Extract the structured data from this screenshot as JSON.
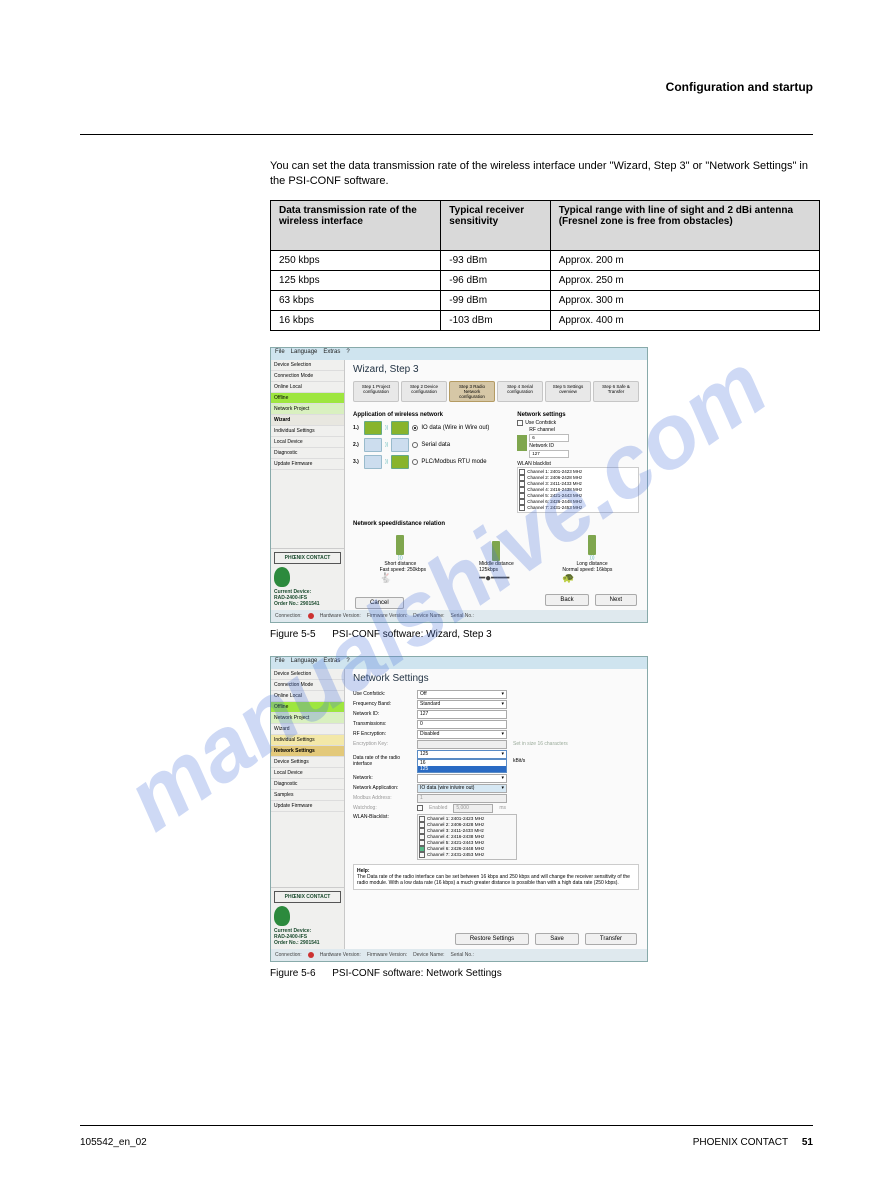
{
  "header": {
    "title": "Configuration and startup"
  },
  "intro": "You can set the data transmission rate of the wireless interface under \"Wizard, Step 3\" or \"Network Settings\" in the PSI-CONF software.",
  "table": {
    "headers": [
      "Data transmission rate of the wireless interface",
      "Typical receiver sensitivity",
      "Typical range with line of sight and 2 dBi antenna (Fresnel zone is free from obstacles)"
    ],
    "rows": [
      [
        "250 kbps",
        "-93 dBm",
        "Approx. 200 m"
      ],
      [
        "125 kbps",
        "-96 dBm",
        "Approx. 250 m"
      ],
      [
        "63 kbps",
        "-99 dBm",
        "Approx. 300 m"
      ],
      [
        "16 kbps",
        "-103 dBm",
        "Approx. 400 m"
      ]
    ]
  },
  "fig_a": {
    "caption_num": "Figure 5-5",
    "caption_text": "PSI-CONF software: Wizard, Step 3",
    "menu": [
      "File",
      "Language",
      "Extras",
      "?"
    ],
    "sidebar": [
      "Device Selection",
      "Connection Mode",
      "Online Local",
      "Offline",
      "Network Project",
      "Wizard",
      "Individual Settings",
      "Local Device",
      "Diagnostic",
      "",
      "Update Firmware"
    ],
    "panel_title": "Wizard, Step 3",
    "steps": [
      "Step 1\nProject configuration",
      "Step 2\nDevice configuration",
      "Step 3\nRadio Network configuration",
      "Step 4\nSerial configuration",
      "Step 5\nSettings overview",
      "Step 6\nSafe & Transfer"
    ],
    "section_app": "Application of wireless network",
    "section_net": "Network settings",
    "app_opts": [
      "IO data (Wire in Wire out)",
      "Serial data",
      "PLC/Modbus RTU mode"
    ],
    "net": {
      "use_confstick": "Use Confstick",
      "rf_channel": "RF channel",
      "rf_value": "6",
      "network_id": "Network ID",
      "network_id_value": "127",
      "block_label": "WLAN blacklist",
      "channels": [
        "Channel 1: 2401-2423 MHz",
        "Channel 2: 2406-2428 MHz",
        "Channel 3: 2411-2433 MHz",
        "Channel 4: 2416-2438 MHz",
        "Channel 5: 2421-2443 MHz",
        "Channel 6: 2426-2448 MHz",
        "Channel 7: 2431-2453 MHz"
      ],
      "chan_icon": "▦"
    },
    "speed": {
      "label": "Network speed/distance relation",
      "short": "Short distance",
      "middle": "Middle distance",
      "long": "Long distance",
      "fast": "Fast speed: 250kbps",
      "mid": "125kbps",
      "normal": "Normal speed: 16kbps"
    },
    "back": "Back",
    "next": "Next",
    "cancel": "Cancel",
    "brand": "PHŒNIX CONTACT",
    "current": "Current Device:",
    "dev": "RAD-2400-IFS",
    "ord": "Order No.: 2901541",
    "status": [
      "Connection:",
      "Hardware Version:",
      "Firmware Version:",
      "Device Name:",
      "Serial No.:"
    ]
  },
  "fig_b": {
    "caption_num": "Figure 5-6",
    "caption_text": "PSI-CONF software: Network Settings",
    "menu": [
      "File",
      "Language",
      "Extras",
      "?"
    ],
    "sidebar": [
      "Device Selection",
      "Connection Mode",
      "Online Local",
      "Offline",
      "Network Project",
      "Wizard",
      "Individual Settings",
      "Network Settings",
      "Device Settings",
      "Local Device",
      "Diagnostic",
      "Samples",
      "Update Firmware"
    ],
    "panel_title": "Network Settings",
    "fields": {
      "use_confstick": {
        "label": "Use Confstick:",
        "value": "Off"
      },
      "freq_band": {
        "label": "Frequency Band:",
        "value": "Standard"
      },
      "network_id": {
        "label": "Network ID:",
        "value": "127"
      },
      "transmissions": {
        "label": "Transmissions:",
        "value": "0"
      },
      "rf_encryption": {
        "label": "RF Encryption:",
        "value": "Disabled"
      },
      "enc_key": {
        "label": "Encryption Key:",
        "hint": "Set in size 16 characters"
      },
      "data_rate": {
        "label": "Data rate of the radio interface",
        "value": "125",
        "unit": " kBit/s",
        "opts": [
          "16",
          "125"
        ]
      },
      "network": {
        "label": "Network:",
        "value": ""
      },
      "net_app": {
        "label": "Network Application:",
        "value": "IO data (wire in/wire out)"
      },
      "modbus": {
        "label": "Modbus Address:",
        "value": "1"
      },
      "watchdog": {
        "label": "Watchdog:",
        "enabled": "Enabled",
        "value": "5,000",
        "unit": "ms"
      },
      "wlan": {
        "label": "WLAN-Blacklist:",
        "channels": [
          "Channel 1: 2401-2423 MHz",
          "Channel 2: 2406-2428 MHz",
          "Channel 3: 2411-2433 MHz",
          "Channel 4: 2416-2438 MHz",
          "Channel 5: 2421-2443 MHz",
          "Channel 6: 2426-2448 MHz",
          "Channel 7: 2431-2453 MHz"
        ]
      }
    },
    "help_label": "Help:",
    "help_text": "The Data rate of the radio interface can be set between 16 kbps and 250 kbps and will change the receiver sensitivity of the radio module. With a low data rate (16 kbps) a much greater distance is possible than with a high data rate (250 kbps).",
    "btn_restore": "Restore Settings",
    "btn_save": "Save",
    "btn_transfer": "Transfer",
    "brand": "PHŒNIX CONTACT",
    "current": "Current Device:",
    "dev": "RAD-2400-IFS",
    "ord": "Order No.: 2901541",
    "status": [
      "Connection:",
      "Hardware Version:",
      "Firmware Version:",
      "Device Name:",
      "Serial No.:"
    ]
  },
  "footer": {
    "doc": "105542_en_02",
    "right": "PHOENIX CONTACT",
    "page": "51"
  },
  "watermark": "manualshive.com"
}
